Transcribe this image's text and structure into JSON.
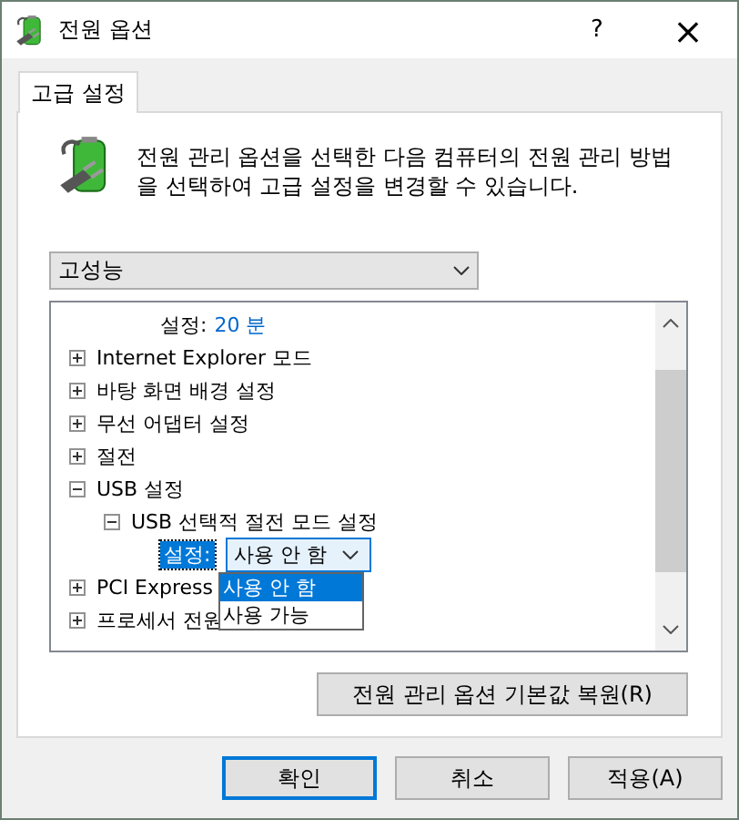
{
  "window": {
    "title": "전원 옵션",
    "help": "?",
    "close": "×"
  },
  "tabs": [
    {
      "label": "고급 설정",
      "selected": true
    }
  ],
  "description": "전원 관리 옵션을 선택한 다음 컴퓨터의 전원 관리 방법을 선택하여 고급 설정을 변경할 수 있습니다.",
  "plan": {
    "value": "고성능"
  },
  "tree": [
    {
      "kind": "setting",
      "label": "설정:",
      "value": "20 분",
      "editing": false
    },
    {
      "kind": "group",
      "label": "Internet Explorer 모드",
      "expanded": false
    },
    {
      "kind": "group",
      "label": "바탕 화면 배경 설정",
      "expanded": false
    },
    {
      "kind": "group",
      "label": "무선 어댑터 설정",
      "expanded": false
    },
    {
      "kind": "group",
      "label": "절전",
      "expanded": false
    },
    {
      "kind": "group",
      "label": "USB 설정",
      "expanded": true,
      "children": [
        {
          "kind": "group",
          "label": "USB 선택적 절전 모드 설정",
          "expanded": true,
          "children": [
            {
              "kind": "setting",
              "label": "설정:",
              "value": "사용 안 함",
              "editing": true,
              "options": [
                {
                  "label": "사용 안 함",
                  "selected": true
                },
                {
                  "label": "사용 가능",
                  "selected": false
                }
              ]
            }
          ]
        }
      ]
    },
    {
      "kind": "group",
      "label": "PCI Express",
      "expanded": false
    },
    {
      "kind": "group",
      "label": "프로세서 전원",
      "expanded": false
    }
  ],
  "restore_button": "전원 관리 옵션 기본값 복원(R)",
  "buttons": [
    {
      "label": "확인",
      "default": true
    },
    {
      "label": "취소",
      "default": false
    },
    {
      "label": "적용(A)",
      "default": false
    }
  ]
}
